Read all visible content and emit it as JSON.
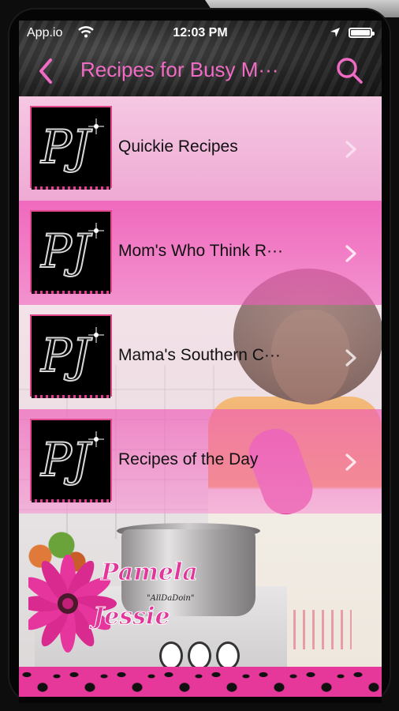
{
  "status_bar": {
    "carrier": "App.io",
    "time": "12:03 PM"
  },
  "nav": {
    "title": "Recipes for Busy M···",
    "back_icon": "chevron-left-icon",
    "search_icon": "search-icon"
  },
  "list": {
    "items": [
      {
        "label": "Quickie Recipes",
        "thumb": "PJ"
      },
      {
        "label": "Mom's Who Think R···",
        "thumb": "PJ"
      },
      {
        "label": "Mama's Southern C···",
        "thumb": "PJ"
      },
      {
        "label": "Recipes of the Day",
        "thumb": "PJ"
      }
    ]
  },
  "brand": {
    "line1": "Pamela",
    "line2": "Jessie",
    "tagline": "\"AllDaDoin\""
  },
  "colors": {
    "accent_pink": "#f06cc4",
    "row_pink": "#f06cb4",
    "leopard_pink": "#e6379a"
  }
}
